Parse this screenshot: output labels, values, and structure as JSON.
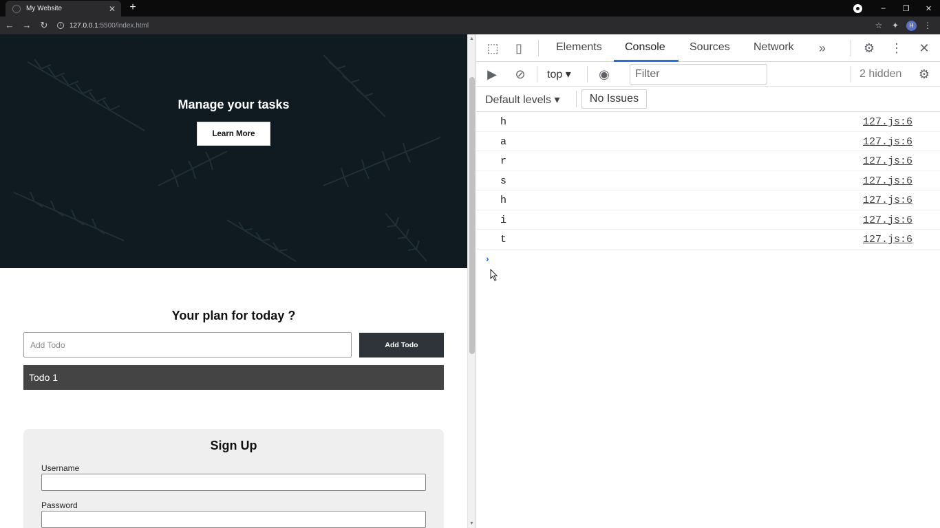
{
  "browser": {
    "tab_title": "My Website",
    "tab_close": "✕",
    "new_tab": "+",
    "url_host": "127.0.0.1",
    "url_path": ":5500/index.html",
    "avatar_letter": "H",
    "window_controls": {
      "minimize": "–",
      "restore": "❐",
      "close": "✕"
    }
  },
  "page": {
    "hero_title": "Manage your tasks",
    "learn_more": "Learn More",
    "plan_title": "Your plan for today ?",
    "todo_placeholder": "Add Todo",
    "add_todo_button": "Add Todo",
    "todos": [
      "Todo 1"
    ],
    "signup": {
      "title": "Sign Up",
      "username_label": "Username",
      "password_label": "Password"
    }
  },
  "devtools": {
    "tabs": [
      "Elements",
      "Console",
      "Sources",
      "Network"
    ],
    "active_tab": "Console",
    "context": "top",
    "filter_placeholder": "Filter",
    "hidden_count": "2 hidden",
    "levels": "Default levels",
    "issues": "No Issues",
    "console_messages": [
      {
        "text": "h",
        "source": "127.js:6"
      },
      {
        "text": "a",
        "source": "127.js:6"
      },
      {
        "text": "r",
        "source": "127.js:6"
      },
      {
        "text": "s",
        "source": "127.js:6"
      },
      {
        "text": "h",
        "source": "127.js:6"
      },
      {
        "text": "i",
        "source": "127.js:6"
      },
      {
        "text": "t",
        "source": "127.js:6"
      }
    ],
    "accent_color": "#1a73e8"
  }
}
